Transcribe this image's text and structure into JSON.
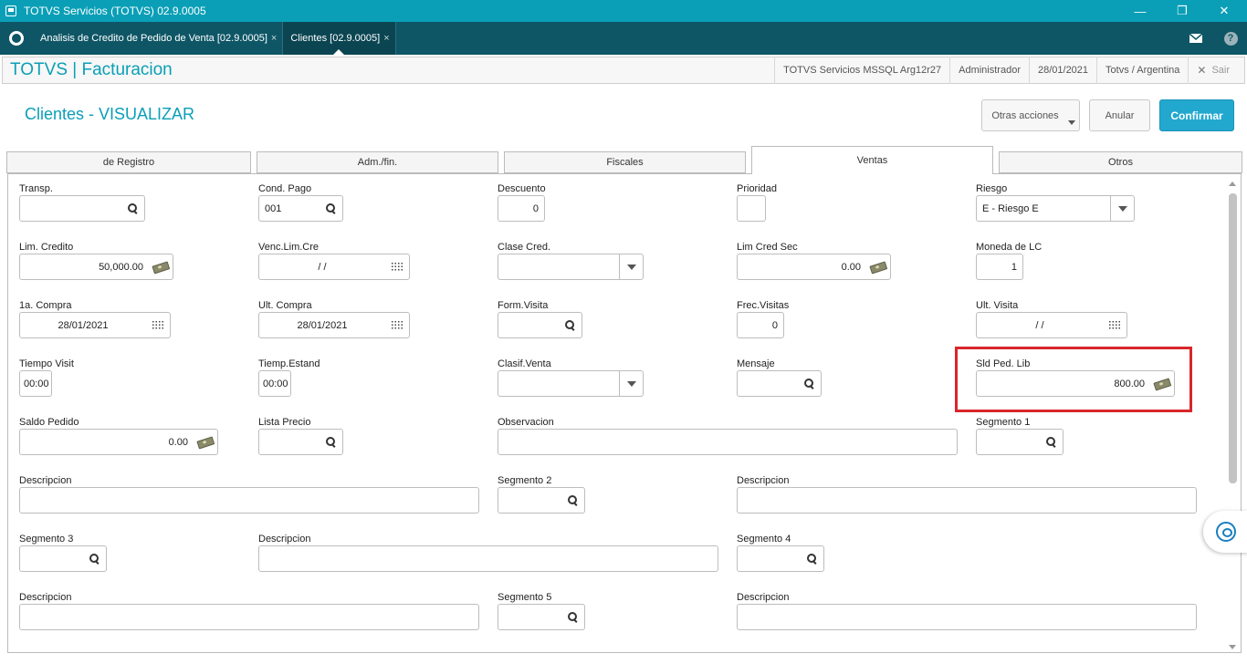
{
  "window": {
    "title": "TOTVS Servicios (TOTVS) 02.9.0005",
    "minimize": "—",
    "restore": "❐",
    "close": "✕"
  },
  "tabs": [
    {
      "label": "Analisis de Credito de Pedido de Venta [02.9.0005]",
      "close": "×"
    },
    {
      "label": "Clientes [02.9.0005]",
      "close": "×"
    }
  ],
  "tabbar_icons": {
    "mail": "mail-icon",
    "help": "help-icon",
    "help_glyph": "?"
  },
  "header": {
    "brand": "TOTVS | Facturacion",
    "server": "TOTVS Servicios MSSQL Arg12r27",
    "user": "Administrador",
    "date": "28/01/2021",
    "company": "Totvs / Argentina",
    "exit": "Sair",
    "exit_glyph": "✕"
  },
  "page": {
    "title": "Clientes - VISUALIZAR",
    "other_actions": "Otras acciones",
    "cancel": "Anular",
    "confirm": "Confirmar"
  },
  "folders": [
    "de Registro",
    "Adm./fin.",
    "Fiscales",
    "Ventas",
    "Otros"
  ],
  "fields": {
    "transp": {
      "label": "Transp.",
      "value": ""
    },
    "cond_pago": {
      "label": "Cond. Pago",
      "value": "001"
    },
    "descuento": {
      "label": "Descuento",
      "value": "0"
    },
    "prioridad": {
      "label": "Prioridad",
      "value": ""
    },
    "riesgo": {
      "label": "Riesgo",
      "value": "E - Riesgo E"
    },
    "lim_credito": {
      "label": "Lim. Credito",
      "value": "50,000.00"
    },
    "venc_lim_cre": {
      "label": "Venc.Lim.Cre",
      "value": "/ /"
    },
    "clase_cred": {
      "label": "Clase Cred.",
      "value": ""
    },
    "lim_cred_sec": {
      "label": "Lim Cred Sec",
      "value": "0.00"
    },
    "moneda_lc": {
      "label": "Moneda de LC",
      "value": "1"
    },
    "primera_compra": {
      "label": "1a. Compra",
      "value": "28/01/2021"
    },
    "ult_compra": {
      "label": "Ult. Compra",
      "value": "28/01/2021"
    },
    "form_visita": {
      "label": "Form.Visita",
      "value": ""
    },
    "frec_visitas": {
      "label": "Frec.Visitas",
      "value": "0"
    },
    "ult_visita": {
      "label": "Ult. Visita",
      "value": "/ /"
    },
    "tiempo_visit": {
      "label": "Tiempo Visit",
      "value": "00:00"
    },
    "tiemp_estand": {
      "label": "Tiemp.Estand",
      "value": "00:00"
    },
    "clasif_venta": {
      "label": "Clasif.Venta",
      "value": ""
    },
    "mensaje": {
      "label": "Mensaje",
      "value": ""
    },
    "sld_ped_lib": {
      "label": "Sld Ped. Lib",
      "value": "800.00"
    },
    "saldo_pedido": {
      "label": "Saldo Pedido",
      "value": "0.00"
    },
    "lista_precio": {
      "label": "Lista Precio",
      "value": ""
    },
    "observacion": {
      "label": "Observacion",
      "value": ""
    },
    "segmento1": {
      "label": "Segmento 1",
      "value": ""
    },
    "descripcion1": {
      "label": "Descripcion",
      "value": ""
    },
    "segmento2": {
      "label": "Segmento 2",
      "value": ""
    },
    "descripcion2": {
      "label": "Descripcion",
      "value": ""
    },
    "segmento3": {
      "label": "Segmento 3",
      "value": ""
    },
    "descripcion3": {
      "label": "Descripcion",
      "value": ""
    },
    "segmento4": {
      "label": "Segmento 4",
      "value": ""
    },
    "descripcion4": {
      "label": "Descripcion",
      "value": ""
    },
    "segmento5": {
      "label": "Segmento 5",
      "value": ""
    },
    "descripcion5": {
      "label": "Descripcion",
      "value": ""
    }
  },
  "colors": {
    "titlebar": "#0a9fb7",
    "tabbar": "#0e5666",
    "brand": "#0a9fb7",
    "primary_button": "#22a8cf",
    "highlight": "#d9262b"
  }
}
